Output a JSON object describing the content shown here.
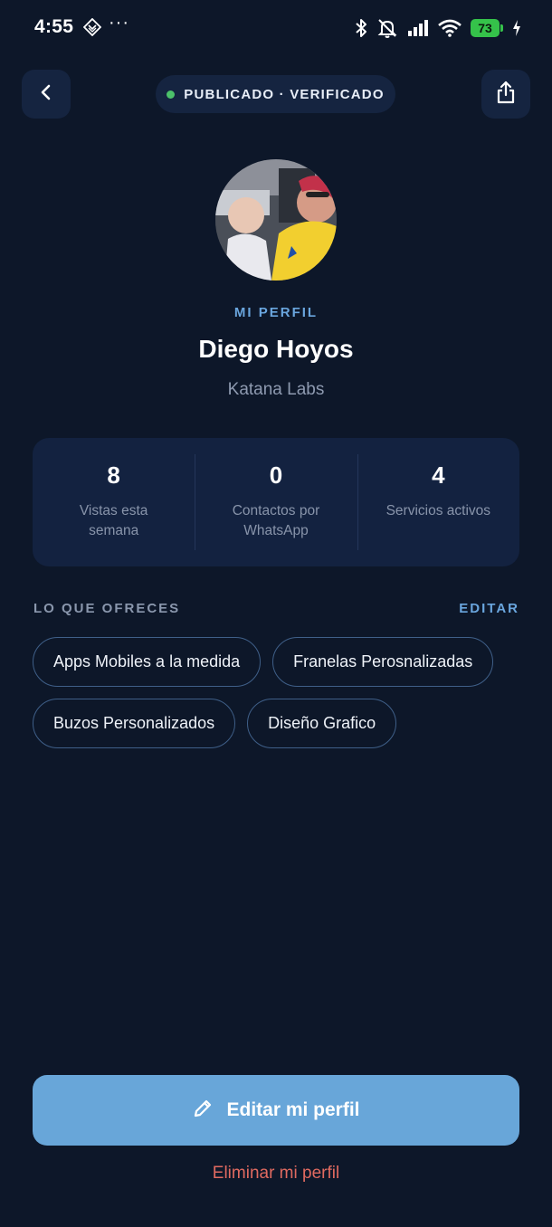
{
  "status_bar": {
    "time": "4:55",
    "dots": "···",
    "battery": "73",
    "icons": [
      "nfc-icon",
      "bluetooth-icon",
      "silent-icon",
      "signal-icon",
      "wifi-icon",
      "battery-icon",
      "charging-icon"
    ]
  },
  "nav": {
    "back_icon": "chevron-left-icon",
    "status": "PUBLICADO · VERIFICADO",
    "status_color": "#4cc16a",
    "share_icon": "share-icon"
  },
  "profile": {
    "eyebrow": "MI PERFIL",
    "name": "Diego Hoyos",
    "company": "Katana Labs"
  },
  "stats": [
    {
      "value": "8",
      "label": "Vistas esta semana"
    },
    {
      "value": "0",
      "label": "Contactos por WhatsApp"
    },
    {
      "value": "4",
      "label": "Servicios activos"
    }
  ],
  "offers": {
    "title": "LO QUE OFRECES",
    "action": "EDITAR",
    "items": [
      "Apps Mobiles a la medida",
      "Franelas Perosnalizadas",
      "Buzos Personalizados",
      "Diseño Grafico"
    ]
  },
  "actions": {
    "primary": "Editar mi perfil",
    "primary_icon": "pencil-icon",
    "danger": "Eliminar mi perfil"
  },
  "colors": {
    "background": "#0d1729",
    "card": "#132240",
    "accent": "#68a6d9",
    "danger": "#e06a60"
  }
}
